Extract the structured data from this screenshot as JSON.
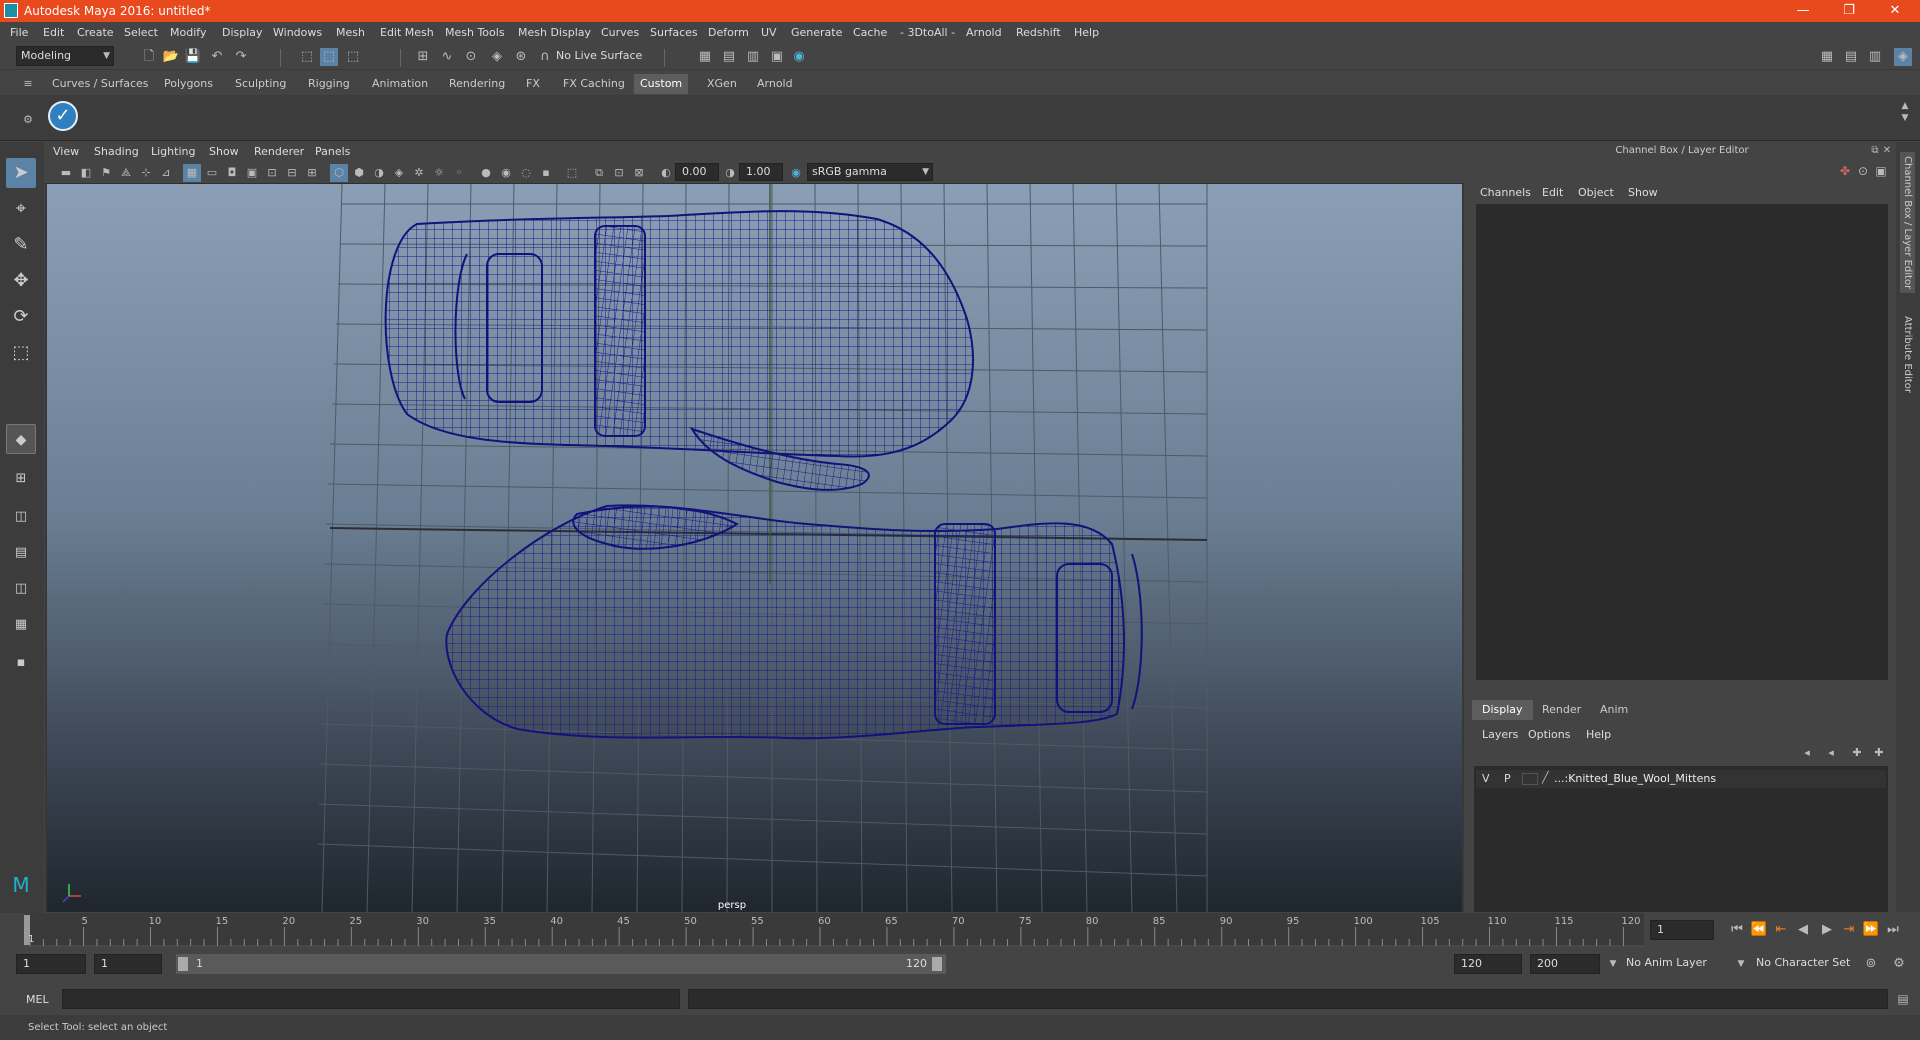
{
  "title": "Autodesk Maya 2016: untitled*",
  "menus": [
    "File",
    "Edit",
    "Create",
    "Select",
    "Modify",
    "Display",
    "Windows",
    "Mesh",
    "Edit Mesh",
    "Mesh Tools",
    "Mesh Display",
    "Curves",
    "Surfaces",
    "Deform",
    "UV",
    "Generate",
    "Cache",
    "- 3DtoAll -",
    "Arnold",
    "Redshift",
    "Help"
  ],
  "toolbar": {
    "mode": "Modeling",
    "live_surface": "No Live Surface"
  },
  "shelf_tabs": [
    "Curves / Surfaces",
    "Polygons",
    "Sculpting",
    "Rigging",
    "Animation",
    "Rendering",
    "FX",
    "FX Caching",
    "Custom",
    "XGen",
    "Arnold"
  ],
  "shelf_active": "Custom",
  "viewport": {
    "menus": [
      "View",
      "Shading",
      "Lighting",
      "Show",
      "Renderer",
      "Panels"
    ],
    "exposure": "0.00",
    "gamma": "1.00",
    "color_space": "sRGB gamma",
    "camera": "persp"
  },
  "channel_box": {
    "title": "Channel Box / Layer Editor",
    "menus": [
      "Channels",
      "Edit",
      "Object",
      "Show"
    ],
    "layer_tabs": [
      "Display",
      "Render",
      "Anim"
    ],
    "layer_active": "Display",
    "layer_menus": [
      "Layers",
      "Options",
      "Help"
    ],
    "layer": {
      "v": "V",
      "p": "P",
      "name": "...:Knitted_Blue_Wool_Mittens"
    }
  },
  "side_tabs": [
    "Channel Box / Layer Editor",
    "Attribute Editor"
  ],
  "timeline": {
    "ticks": [
      "5",
      "10",
      "15",
      "20",
      "25",
      "30",
      "35",
      "40",
      "45",
      "50",
      "55",
      "60",
      "65",
      "70",
      "75",
      "80",
      "85",
      "90",
      "95",
      "100",
      "105",
      "110",
      "115",
      "120"
    ],
    "first": "1",
    "current_frame": "1"
  },
  "range": {
    "start": "1",
    "playback_start": "1",
    "slider_start": "1",
    "slider_end": "120",
    "playback_end": "120",
    "end": "200",
    "anim_layer": "No Anim Layer",
    "character_set": "No Character Set"
  },
  "cmd": {
    "label": "MEL"
  },
  "status": "Select Tool: select an object"
}
